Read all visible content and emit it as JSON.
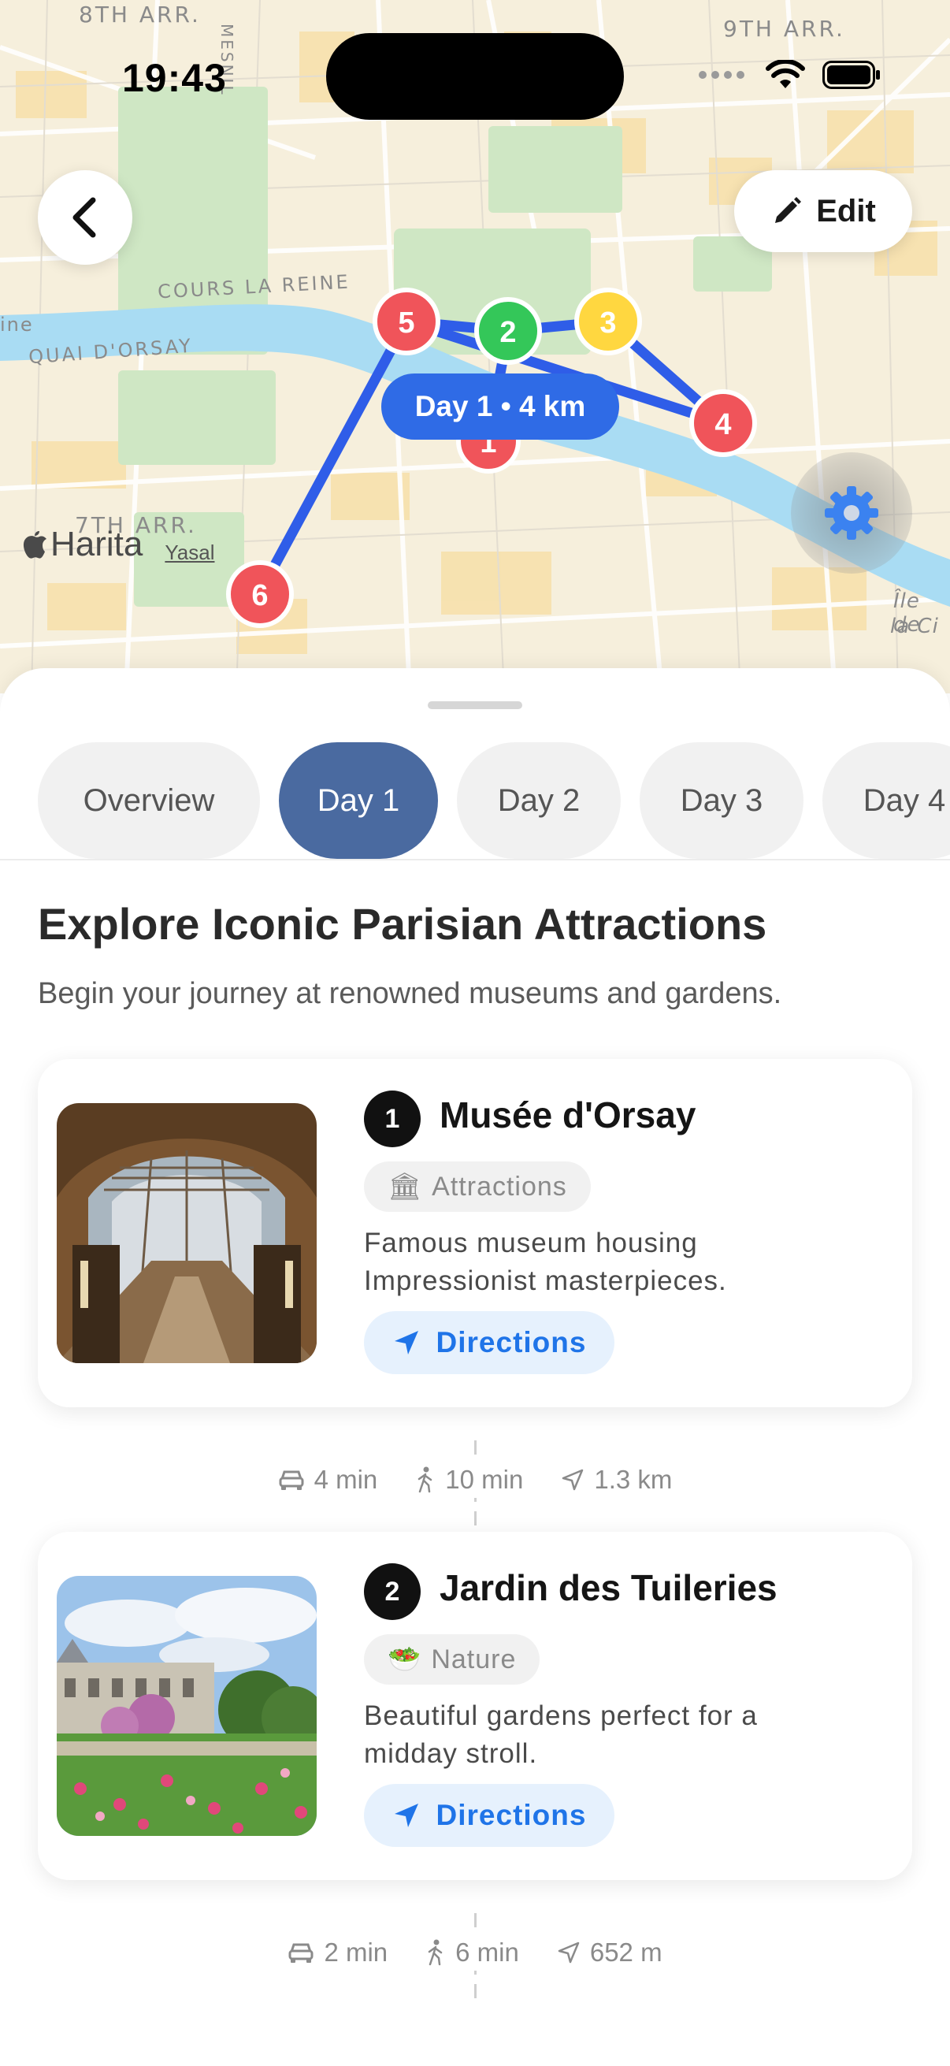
{
  "status_bar": {
    "time": "19:43"
  },
  "map": {
    "labels": {
      "arr8": "8TH ARR.",
      "arr9": "9TH ARR.",
      "arr7": "7TH ARR.",
      "mesnil": "MESNIL",
      "cours": "COURS LA REINE",
      "quai": "QUAI D'ORSAY",
      "seine": "ine",
      "ile": "Île de",
      "ile2": "la Ci"
    },
    "attribution_brand": "Harita",
    "attribution_legal": "Yasal",
    "day_summary": "Day 1 • 4 km",
    "markers": [
      "5",
      "2",
      "3",
      "4",
      "1",
      "6"
    ],
    "marker_colors": {
      "red": "#f0545a",
      "green": "#34c759",
      "yellow": "#ffd740",
      "route": "#2f5de8"
    }
  },
  "header": {
    "edit_label": "Edit"
  },
  "tabs": [
    {
      "label": "Overview",
      "active": false
    },
    {
      "label": "Day 1",
      "active": true
    },
    {
      "label": "Day 2",
      "active": false
    },
    {
      "label": "Day 3",
      "active": false
    },
    {
      "label": "Day 4",
      "active": false
    }
  ],
  "day": {
    "title": "Explore Iconic Parisian Attractions",
    "subtitle": "Begin your journey at renowned museums and gardens."
  },
  "places": [
    {
      "number": "1",
      "name": "Musée d'Orsay",
      "category": "Attractions",
      "category_icon": "🏛",
      "description_line1": "Famous museum housing",
      "description_line2": "Impressionist masterpieces.",
      "directions_label": "Directions"
    },
    {
      "number": "2",
      "name": "Jardin des Tuileries",
      "category": "Nature",
      "category_icon": "🥗",
      "description_line1": "Beautiful gardens perfect for a",
      "description_line2": "midday stroll.",
      "directions_label": "Directions"
    }
  ],
  "travel_segments": [
    {
      "drive": "4 min",
      "walk": "10 min",
      "distance": "1.3 km"
    },
    {
      "drive": "2 min",
      "walk": "6 min",
      "distance": "652 m"
    }
  ],
  "colors": {
    "accent_tab": "#4a6aa0",
    "directions_text": "#1f74e8",
    "directions_bg": "#e6f1fd"
  }
}
